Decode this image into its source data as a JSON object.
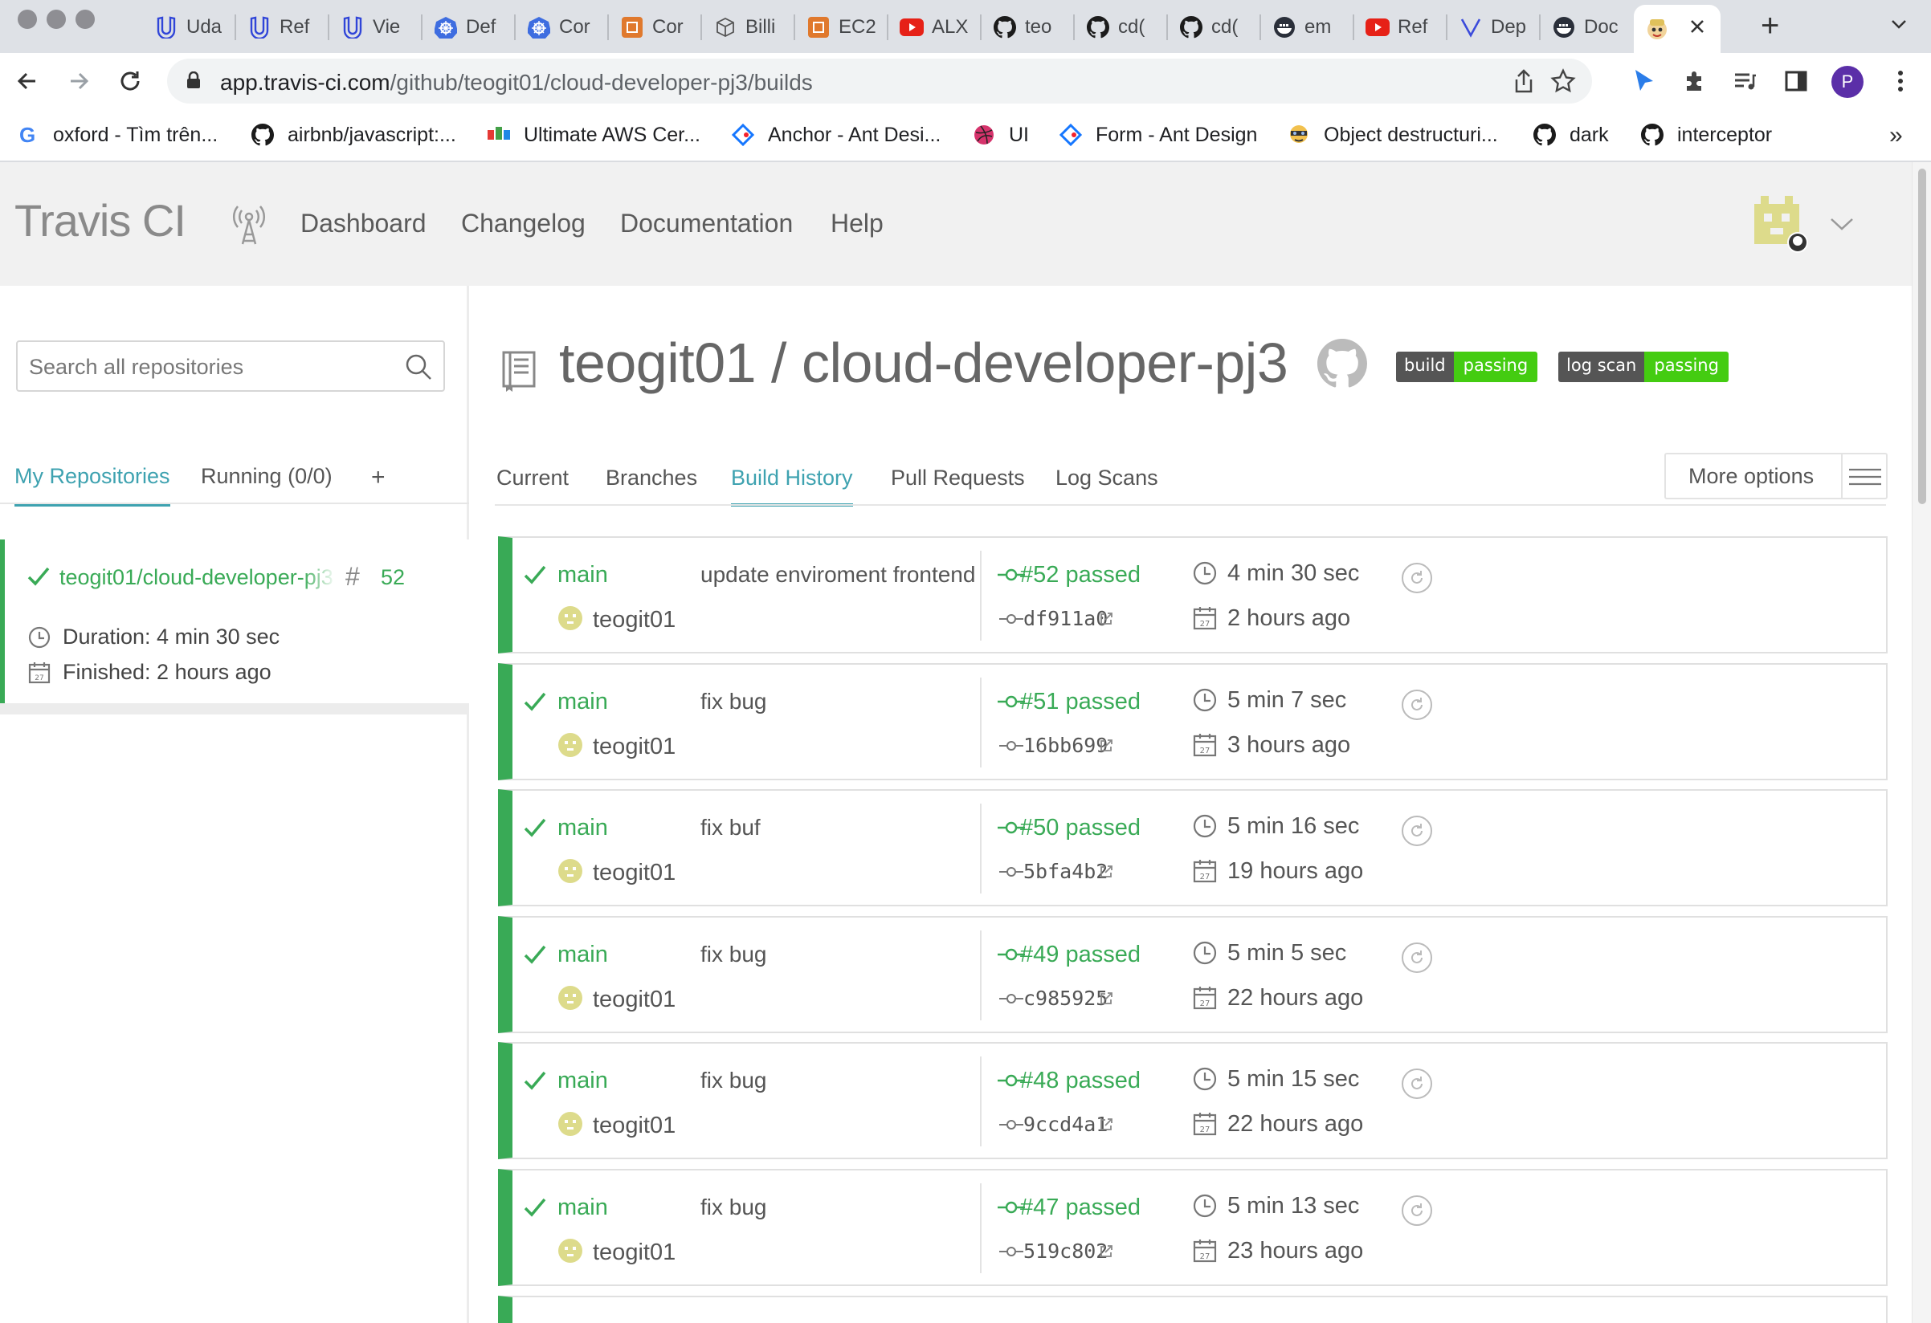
{
  "browser": {
    "tabs": [
      {
        "title": "Uda",
        "icon": "udacity-icon"
      },
      {
        "title": "Ref",
        "icon": "udacity-icon"
      },
      {
        "title": "Vie",
        "icon": "udacity-icon"
      },
      {
        "title": "Def",
        "icon": "kubernetes-icon"
      },
      {
        "title": "Cor",
        "icon": "kubernetes-icon"
      },
      {
        "title": "Cor",
        "icon": "aws-icon"
      },
      {
        "title": "Billi",
        "icon": "cube-icon"
      },
      {
        "title": "EC2",
        "icon": "aws-icon"
      },
      {
        "title": "ALX",
        "icon": "youtube-icon"
      },
      {
        "title": "teo",
        "icon": "github-icon"
      },
      {
        "title": "cd(",
        "icon": "github-icon"
      },
      {
        "title": "cd(",
        "icon": "github-icon"
      },
      {
        "title": "em",
        "icon": "docker-icon"
      },
      {
        "title": "Ref",
        "icon": "youtube-icon"
      },
      {
        "title": "Dep",
        "icon": "vercel-icon"
      },
      {
        "title": "Doc",
        "icon": "docker-icon"
      },
      {
        "title": "",
        "icon": "travis-icon",
        "active": true
      }
    ],
    "url_host": "app.travis-ci.com",
    "url_path": "/github/teogit01/cloud-developer-pj3/builds",
    "profile_initial": "P",
    "bookmarks": [
      {
        "label": "oxford - Tìm trên...",
        "icon": "google-icon"
      },
      {
        "label": "airbnb/javascript:...",
        "icon": "github-icon"
      },
      {
        "label": "Ultimate AWS Cer...",
        "icon": "udemy-icon"
      },
      {
        "label": "Anchor - Ant Desi...",
        "icon": "antd-icon"
      },
      {
        "label": "UI",
        "icon": "dribbble-icon"
      },
      {
        "label": "Form - Ant Design",
        "icon": "antd-icon"
      },
      {
        "label": "Object destructuri...",
        "icon": "js-info-icon"
      },
      {
        "label": "dark",
        "icon": "github-icon"
      },
      {
        "label": "interceptor",
        "icon": "github-icon"
      }
    ],
    "bookmarks_more": "»"
  },
  "header": {
    "logo": "Travis CI",
    "nav": [
      "Dashboard",
      "Changelog",
      "Documentation",
      "Help"
    ]
  },
  "sidebar": {
    "search_placeholder": "Search all repositories",
    "tabs": [
      "My Repositories",
      "Running (0/0)",
      "+"
    ],
    "repo": {
      "name": "teogit01/cloud-developer-pj3",
      "hash_symbol": "#",
      "build_number": "52",
      "duration": "Duration: 4 min 30 sec",
      "finished": "Finished: 2 hours ago"
    }
  },
  "main": {
    "title": "teogit01 / cloud-developer-pj3",
    "badges": [
      {
        "left": "build",
        "right": "passing"
      },
      {
        "left": "log scan",
        "right": "passing"
      }
    ],
    "tabs": [
      "Current",
      "Branches",
      "Build History",
      "Pull Requests",
      "Log Scans"
    ],
    "active_tab": "Build History",
    "more_options": "More options",
    "builds": [
      {
        "branch": "main",
        "author": "teogit01",
        "message": "update enviroment frontend",
        "number": "#52 passed",
        "sha": "df911a0",
        "duration": "4 min 30 sec",
        "ago": "2 hours ago"
      },
      {
        "branch": "main",
        "author": "teogit01",
        "message": "fix bug",
        "number": "#51 passed",
        "sha": "16bb699",
        "duration": "5 min 7 sec",
        "ago": "3 hours ago"
      },
      {
        "branch": "main",
        "author": "teogit01",
        "message": "fix buf",
        "number": "#50 passed",
        "sha": "5bfa4b2",
        "duration": "5 min 16 sec",
        "ago": "19 hours ago"
      },
      {
        "branch": "main",
        "author": "teogit01",
        "message": "fix bug",
        "number": "#49 passed",
        "sha": "c985925",
        "duration": "5 min 5 sec",
        "ago": "22 hours ago"
      },
      {
        "branch": "main",
        "author": "teogit01",
        "message": "fix bug",
        "number": "#48 passed",
        "sha": "9ccd4a1",
        "duration": "5 min 15 sec",
        "ago": "22 hours ago"
      },
      {
        "branch": "main",
        "author": "teogit01",
        "message": "fix bug",
        "number": "#47 passed",
        "sha": "519c802",
        "duration": "5 min 13 sec",
        "ago": "23 hours ago"
      }
    ]
  },
  "colors": {
    "passed": "#39aa56",
    "accent": "#3ea2b0",
    "badge_dark": "#555555",
    "badge_green": "#44cc11"
  }
}
